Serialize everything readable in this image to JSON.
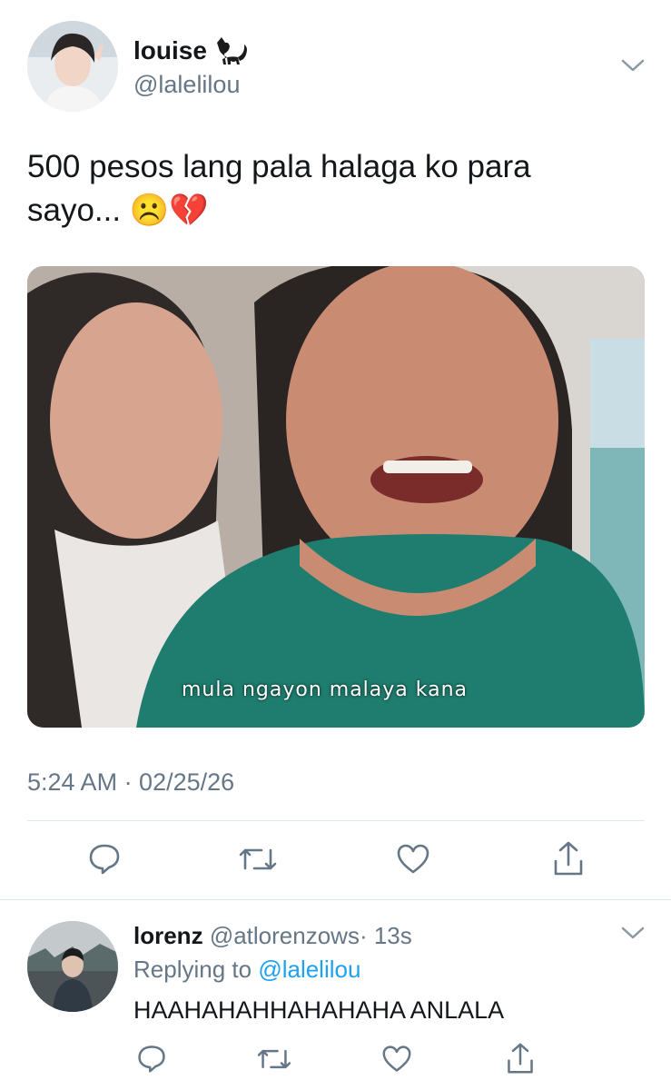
{
  "tweet": {
    "display_name": "louise",
    "name_emoji": "🐈‍⬛",
    "handle": "@lalelilou",
    "text_line1": "500 pesos lang pala halaga ko para",
    "text_line2": "sayo... ☹️💔",
    "media_caption": "mula ngayon malaya kana",
    "timestamp": "5:24 AM · 02/25/26"
  },
  "reply": {
    "display_name": "lorenz",
    "handle": "@atlorenzows",
    "time": "· 13s",
    "replying_prefix": "Replying to",
    "replying_to": "@lalelilou",
    "text": "HAAHAHAHHAHAHAHA ANLALA"
  },
  "actions": {
    "icons": [
      "reply-icon",
      "retweet-icon",
      "like-icon",
      "share-icon"
    ]
  },
  "colors": {
    "accent": "#1da1f2",
    "muted": "#657786",
    "divider": "#e1e8ed"
  }
}
